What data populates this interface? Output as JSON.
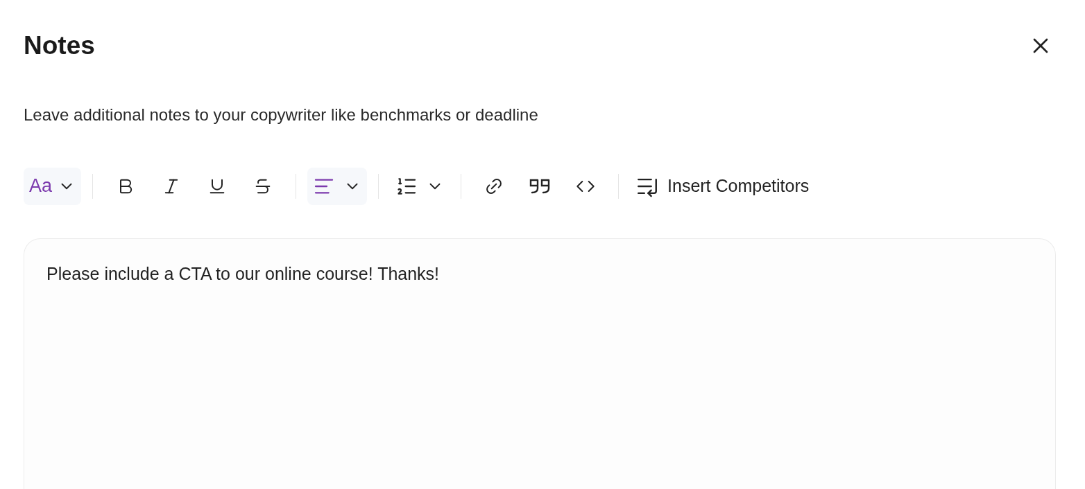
{
  "dialog": {
    "title": "Notes",
    "description": "Leave additional notes to your copywriter like benchmarks or deadline"
  },
  "toolbar": [
    {
      "kind": "font",
      "label": "Aa",
      "active": true
    },
    {
      "kind": "separator"
    },
    {
      "kind": "bold"
    },
    {
      "kind": "italic"
    },
    {
      "kind": "underline"
    },
    {
      "kind": "strike"
    },
    {
      "kind": "separator"
    },
    {
      "kind": "align",
      "active": true
    },
    {
      "kind": "separator"
    },
    {
      "kind": "list",
      "active": false
    },
    {
      "kind": "separator"
    },
    {
      "kind": "link"
    },
    {
      "kind": "quote"
    },
    {
      "kind": "code"
    },
    {
      "kind": "separator"
    },
    {
      "kind": "insert",
      "label": "Insert Competitors"
    }
  ],
  "editor": {
    "value": "Please include a CTA to our online course! Thanks!"
  }
}
